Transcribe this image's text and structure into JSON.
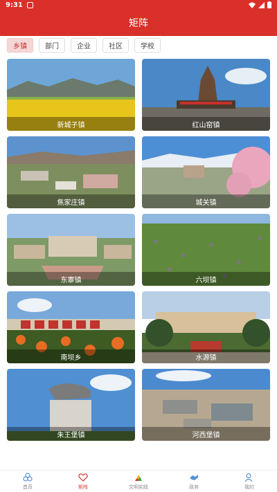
{
  "status": {
    "time": "9:31"
  },
  "header": {
    "title": "矩阵"
  },
  "tabs": [
    {
      "label": "乡镇",
      "active": true
    },
    {
      "label": "部门",
      "active": false
    },
    {
      "label": "企业",
      "active": false
    },
    {
      "label": "社区",
      "active": false
    },
    {
      "label": "学校",
      "active": false
    }
  ],
  "cards": [
    {
      "label": "新城子镇",
      "icon": "canola-field-image"
    },
    {
      "label": "红山窑镇",
      "icon": "monument-image"
    },
    {
      "label": "焦家庄镇",
      "icon": "town-aerial-image"
    },
    {
      "label": "城关镇",
      "icon": "blossom-city-image"
    },
    {
      "label": "东寨镇",
      "icon": "government-building-image"
    },
    {
      "label": "六坝镇",
      "icon": "crop-field-image"
    },
    {
      "label": "南坝乡",
      "icon": "flower-sign-image"
    },
    {
      "label": "水源镇",
      "icon": "square-building-image"
    },
    {
      "label": "朱王堡镇",
      "icon": "ox-statue-image"
    },
    {
      "label": "河西堡镇",
      "icon": "industrial-aerial-image"
    }
  ],
  "bottom_nav": [
    {
      "label": "首页",
      "icon": "home-icon",
      "active": false
    },
    {
      "label": "矩阵",
      "icon": "matrix-icon",
      "active": true
    },
    {
      "label": "文明实践",
      "icon": "practice-icon",
      "active": false
    },
    {
      "label": "政务",
      "icon": "handshake-icon",
      "active": false
    },
    {
      "label": "我的",
      "icon": "user-icon",
      "active": false
    }
  ],
  "colors": {
    "brand": "#d9302a",
    "tab_active_bg": "#f4d7d6"
  }
}
